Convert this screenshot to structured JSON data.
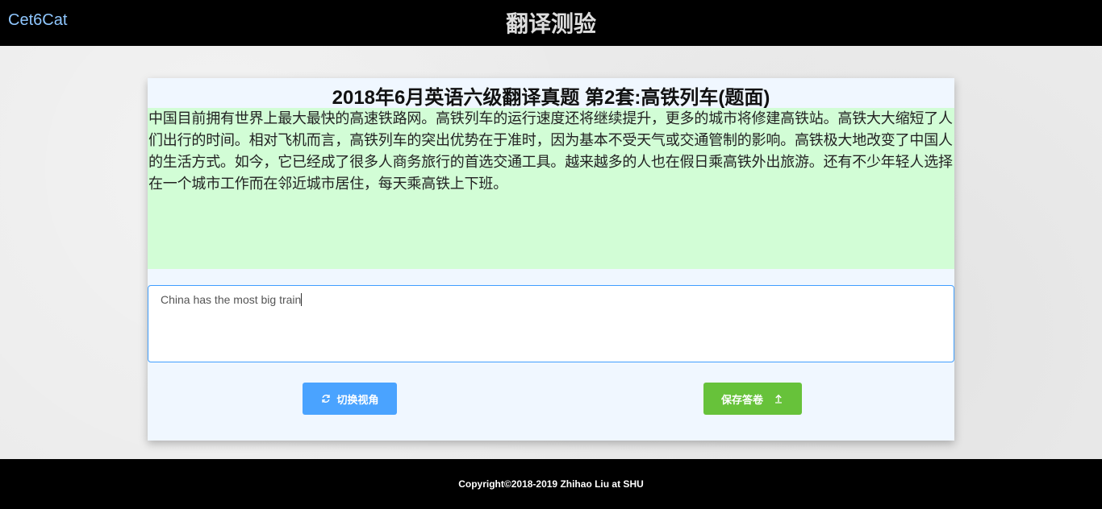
{
  "header": {
    "brand": "Cet6Cat",
    "title": "翻译测验"
  },
  "question": {
    "title": "2018年6月英语六级翻译真题 第2套:高铁列车(题面)",
    "text": "中国目前拥有世界上最大最快的高速铁路网。高铁列车的运行速度还将继续提升，更多的城市将修建高铁站。高铁大大缩短了人们出行的时间。相对飞机而言，高铁列车的突出优势在于准时，因为基本不受天气或交通管制的影响。高铁极大地改变了中国人的生活方式。如今，它已经成了很多人商务旅行的首选交通工具。越来越多的人也在假日乘高铁外出旅游。还有不少年轻人选择在一个城市工作而在邻近城市居住，每天乘高铁上下班。"
  },
  "answer": {
    "value": "China has the most big train"
  },
  "buttons": {
    "switch_label": "切换视角",
    "save_label": "保存答卷"
  },
  "footer": {
    "copyright": "Copyright©2018-2019 Zhihao Liu at SHU"
  },
  "colors": {
    "topbar": "#000000",
    "brand": "#8fc7ff",
    "question_bg": "#d2fdd6",
    "card_bg": "#f0f7ff",
    "switch_button": "#4aa3ff",
    "save_button": "#67c23a",
    "input_border": "#409eff"
  },
  "icons": {
    "switch": "refresh-icon",
    "save": "upload-icon"
  }
}
